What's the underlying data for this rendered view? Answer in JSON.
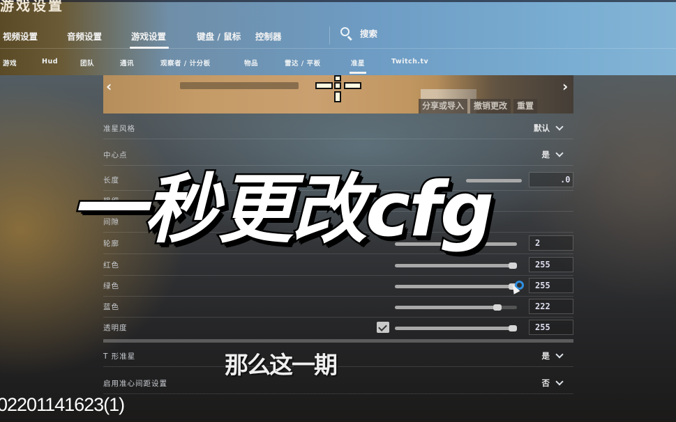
{
  "window": {
    "title": "游戏设置"
  },
  "main_tabs": [
    {
      "label": "视频设置"
    },
    {
      "label": "音频设置"
    },
    {
      "label": "游戏设置",
      "active": true
    },
    {
      "label": "键盘 / 鼠标"
    },
    {
      "label": "控制器"
    }
  ],
  "search": {
    "label": "搜索",
    "icon": "search-icon"
  },
  "sub_tabs": [
    {
      "label": "游戏"
    },
    {
      "label": "Hud"
    },
    {
      "label": "团队"
    },
    {
      "label": "通讯"
    },
    {
      "label": "观察者 / 计分板"
    },
    {
      "label": "物品"
    },
    {
      "label": "雷达 / 平板"
    },
    {
      "label": "准星",
      "active": true
    },
    {
      "label": "Twitch.tv"
    }
  ],
  "preview": {
    "prev_icon": "chevron-left-icon",
    "next_icon": "chevron-right-icon",
    "buttons": {
      "share": "分享或导入",
      "undo": "撤销更改",
      "reset": "重置"
    }
  },
  "settings": {
    "crosshair_style": {
      "label": "准星风格",
      "value": "默认"
    },
    "center_dot": {
      "label": "中心点",
      "value": "是"
    },
    "length": {
      "label": "长度",
      "value": ".0"
    },
    "thickness": {
      "label": "粗细"
    },
    "gap": {
      "label": "间隙"
    },
    "outline": {
      "label": "轮廓",
      "value": "2"
    },
    "red": {
      "label": "红色",
      "value": "255",
      "fraction": 1.0
    },
    "green": {
      "label": "绿色",
      "value": "255",
      "fraction": 1.0
    },
    "blue": {
      "label": "蓝色",
      "value": "222",
      "fraction": 0.87
    },
    "alpha": {
      "label": "透明度",
      "value": "255",
      "fraction": 1.0,
      "checked": true
    },
    "t_style": {
      "label": "T 形准星",
      "value": "是"
    },
    "gap_setting": {
      "label": "启用准心间距设置",
      "value": "否"
    }
  },
  "overlay": {
    "title_caption": "一秒更改cfg",
    "subtitle_caption": "那么这一期",
    "filename": "02201141623(1)"
  },
  "colors": {
    "focus_ring": "#2f8fe0"
  }
}
